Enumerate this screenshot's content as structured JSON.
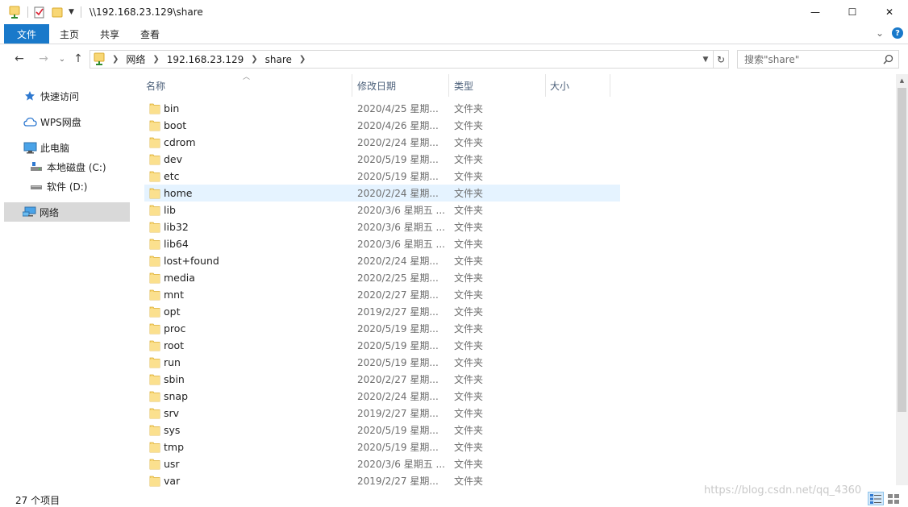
{
  "titlebar": {
    "path": "\\\\192.168.23.129\\share",
    "minimize": "—",
    "maximize": "☐",
    "close": "✕"
  },
  "ribbon": {
    "tabs": [
      "文件",
      "主页",
      "共享",
      "查看"
    ],
    "expand": "⌄",
    "help": "?"
  },
  "nav": {
    "back": "←",
    "forward": "→",
    "recent": "⌄",
    "up": "↑",
    "breadcrumbs": [
      "网络",
      "192.168.23.129",
      "share"
    ],
    "refresh": "↻",
    "search_placeholder": "搜索\"share\""
  },
  "sidebar": {
    "items": [
      {
        "label": "快速访问",
        "icon": "star-icon"
      },
      {
        "label": "WPS网盘",
        "icon": "cloud-icon"
      },
      {
        "label": "此电脑",
        "icon": "computer-icon"
      },
      {
        "label": "本地磁盘 (C:)",
        "icon": "drive-c-icon"
      },
      {
        "label": "软件 (D:)",
        "icon": "drive-d-icon"
      },
      {
        "label": "网络",
        "icon": "network-icon"
      }
    ],
    "selected": "网络"
  },
  "columns": [
    "名称",
    "修改日期",
    "类型",
    "大小"
  ],
  "files": [
    {
      "name": "bin",
      "date": "2020/4/25 星期...",
      "type": "文件夹"
    },
    {
      "name": "boot",
      "date": "2020/4/26 星期...",
      "type": "文件夹"
    },
    {
      "name": "cdrom",
      "date": "2020/2/24 星期...",
      "type": "文件夹"
    },
    {
      "name": "dev",
      "date": "2020/5/19 星期...",
      "type": "文件夹"
    },
    {
      "name": "etc",
      "date": "2020/5/19 星期...",
      "type": "文件夹"
    },
    {
      "name": "home",
      "date": "2020/2/24 星期...",
      "type": "文件夹"
    },
    {
      "name": "lib",
      "date": "2020/3/6 星期五 ...",
      "type": "文件夹"
    },
    {
      "name": "lib32",
      "date": "2020/3/6 星期五 ...",
      "type": "文件夹"
    },
    {
      "name": "lib64",
      "date": "2020/3/6 星期五 ...",
      "type": "文件夹"
    },
    {
      "name": "lost+found",
      "date": "2020/2/24 星期...",
      "type": "文件夹"
    },
    {
      "name": "media",
      "date": "2020/2/25 星期...",
      "type": "文件夹"
    },
    {
      "name": "mnt",
      "date": "2020/2/27 星期...",
      "type": "文件夹"
    },
    {
      "name": "opt",
      "date": "2019/2/27 星期...",
      "type": "文件夹"
    },
    {
      "name": "proc",
      "date": "2020/5/19 星期...",
      "type": "文件夹"
    },
    {
      "name": "root",
      "date": "2020/5/19 星期...",
      "type": "文件夹"
    },
    {
      "name": "run",
      "date": "2020/5/19 星期...",
      "type": "文件夹"
    },
    {
      "name": "sbin",
      "date": "2020/2/27 星期...",
      "type": "文件夹"
    },
    {
      "name": "snap",
      "date": "2020/2/24 星期...",
      "type": "文件夹"
    },
    {
      "name": "srv",
      "date": "2019/2/27 星期...",
      "type": "文件夹"
    },
    {
      "name": "sys",
      "date": "2020/5/19 星期...",
      "type": "文件夹"
    },
    {
      "name": "tmp",
      "date": "2020/5/19 星期...",
      "type": "文件夹"
    },
    {
      "name": "usr",
      "date": "2020/3/6 星期五 ...",
      "type": "文件夹"
    },
    {
      "name": "var",
      "date": "2019/2/27 星期...",
      "type": "文件夹"
    }
  ],
  "hovered_file": "home",
  "status": {
    "item_count": "27 个项目"
  },
  "watermark": "https://blog.csdn.net/qq_4360",
  "colors": {
    "accent": "#1979ca",
    "hover_row": "#e5f3ff",
    "selected_nav": "#d9d9d9",
    "folder": "#f8d775"
  }
}
